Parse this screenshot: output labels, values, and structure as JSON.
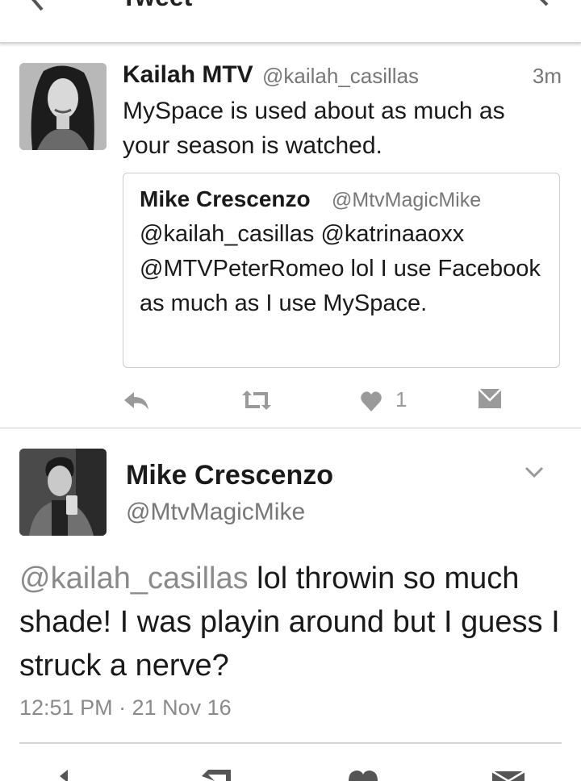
{
  "header": {
    "title": "Tweet",
    "back_icon": "back-arrow-icon",
    "search_icon": "search-icon"
  },
  "tweet": {
    "author_name": "Kailah MTV",
    "author_handle": "@kailah_casillas",
    "time_ago": "3m",
    "text": "MySpace is used about as much as your season is watched.",
    "quoted": {
      "author_name": "Mike Crescenzo",
      "author_handle": "@MtvMagicMike",
      "text": "@kailah_casillas @katrinaaoxx @MTVPeterRomeo lol I use Facebook as much as I use MySpace."
    },
    "actions": {
      "reply_icon": "reply-icon",
      "retweet_icon": "retweet-icon",
      "like_icon": "heart-icon",
      "like_count": "1",
      "dm_icon": "message-icon"
    }
  },
  "reply": {
    "author_name": "Mike Crescenzo",
    "author_handle": "@MtvMagicMike",
    "mention": "@kailah_casillas",
    "text": " lol throwin so much shade! I was playin around but I guess I struck a nerve?",
    "timestamp": "12:51 PM · 21 Nov 16"
  },
  "colors": {
    "text": "#1a1a1a",
    "secondary": "#777777",
    "icon": "#9a9a9a",
    "divider": "#cfcfcf"
  }
}
